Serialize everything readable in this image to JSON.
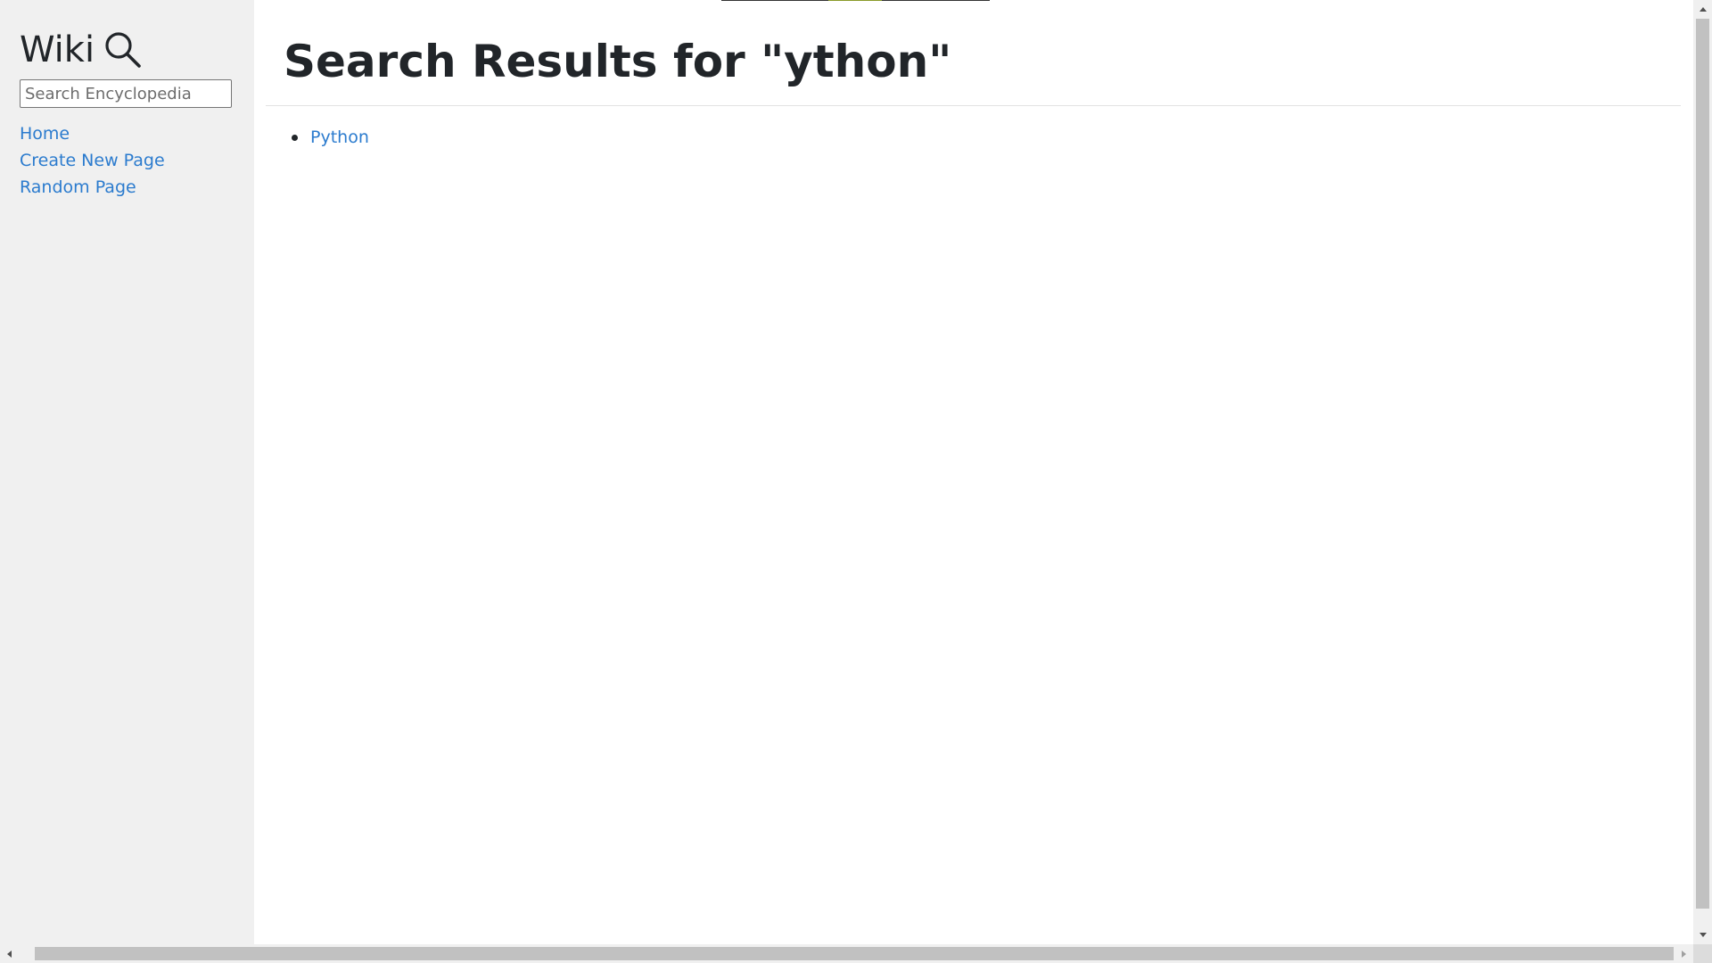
{
  "sidebar": {
    "brand": "Wiki",
    "brand_icon": "search-icon",
    "search_placeholder": "Search Encyclopedia",
    "search_value": "",
    "nav": [
      {
        "label": "Home"
      },
      {
        "label": "Create New Page"
      },
      {
        "label": "Random Page"
      }
    ]
  },
  "main": {
    "title": "Search Results for \"ython\"",
    "results": [
      {
        "label": "Python"
      }
    ]
  },
  "colors": {
    "sidebar_bg": "#f0f0f0",
    "link": "#2b7bce",
    "text": "#212529"
  }
}
